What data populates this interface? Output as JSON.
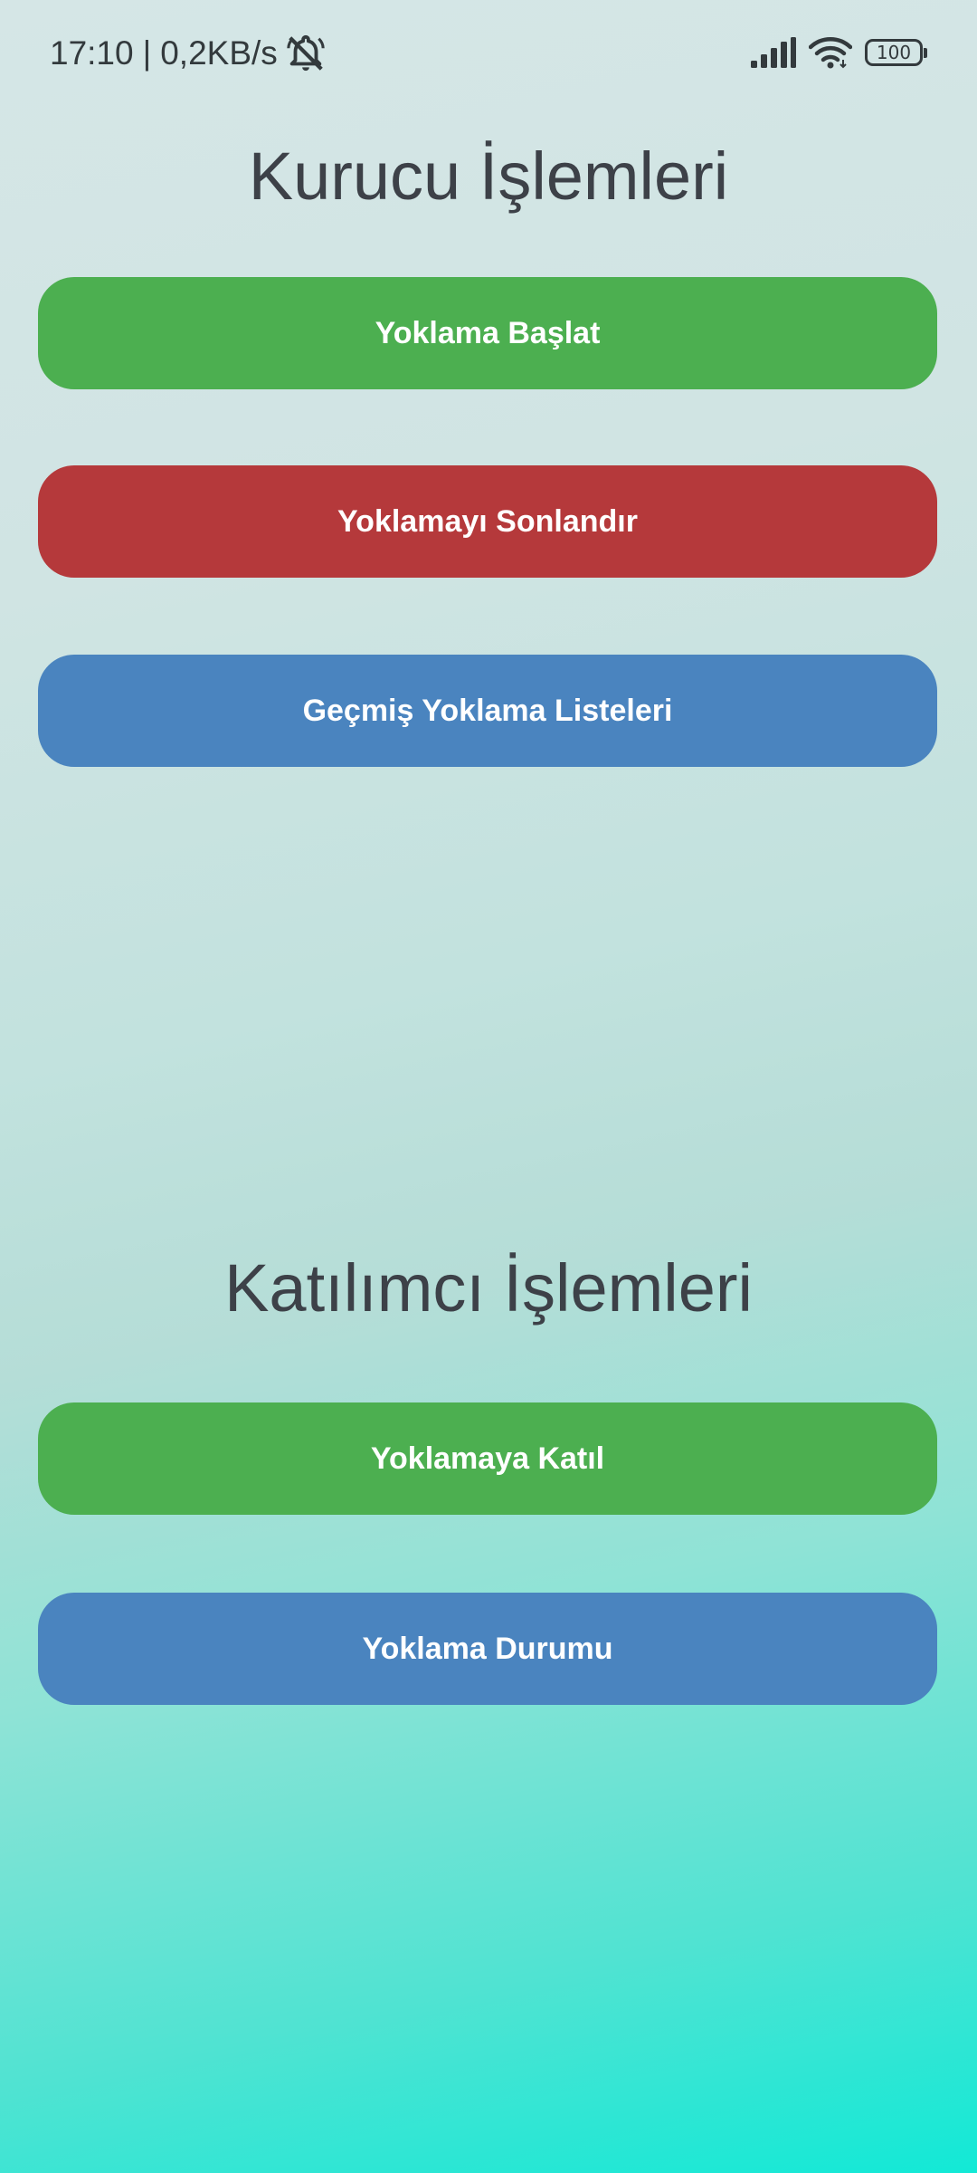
{
  "status_bar": {
    "time": "17:10",
    "separator": "|",
    "network_speed": "0,2KB/s",
    "battery_level": "100",
    "icons": [
      "bell-off-icon",
      "signal-icon",
      "wifi-icon",
      "battery-icon"
    ]
  },
  "founder_section": {
    "title": "Kurucu İşlemleri",
    "buttons": [
      {
        "label": "Yoklama Başlat",
        "color": "#4caf50"
      },
      {
        "label": "Yoklamayı Sonlandır",
        "color": "#b5393b"
      },
      {
        "label": "Geçmiş Yoklama Listeleri",
        "color": "#4a84bf"
      }
    ]
  },
  "participant_section": {
    "title": "Katılımcı İşlemleri",
    "buttons": [
      {
        "label": "Yoklamaya Katıl",
        "color": "#4caf50"
      },
      {
        "label": "Yoklama Durumu",
        "color": "#4a84bf"
      }
    ]
  },
  "colors": {
    "title_text": "#3d4148",
    "status_text": "#333a3d",
    "gradient_top": "#d5e6e6",
    "gradient_bottom": "#12e9d6"
  }
}
